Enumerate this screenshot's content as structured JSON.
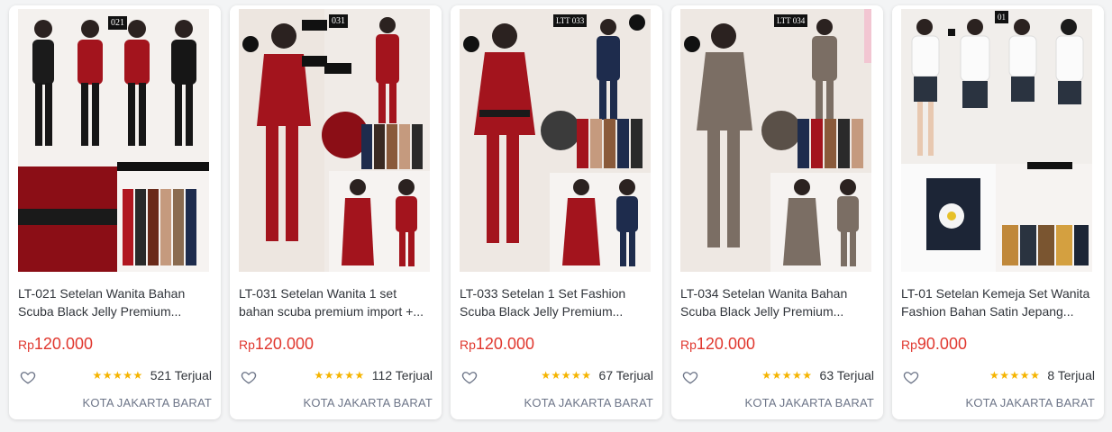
{
  "products": [
    {
      "code_tag": "021",
      "title": "LT-021 Setelan Wanita Bahan Scuba Black Jelly Premium...",
      "currency": "Rp",
      "price": "120.000",
      "stars": "★★★★★",
      "sold": "521 Terjual",
      "location": "KOTA JAKARTA BARAT"
    },
    {
      "code_tag": "031",
      "title": "LT-031 Setelan Wanita 1 set bahan scuba premium import +...",
      "currency": "Rp",
      "price": "120.000",
      "stars": "★★★★★",
      "sold": "112 Terjual",
      "location": "KOTA JAKARTA BARAT"
    },
    {
      "code_tag": "LTT 033",
      "title": "LT-033 Setelan 1 Set Fashion Scuba Black Jelly Premium...",
      "currency": "Rp",
      "price": "120.000",
      "stars": "★★★★★",
      "sold": "67 Terjual",
      "location": "KOTA JAKARTA BARAT"
    },
    {
      "code_tag": "LTT 034",
      "title": "LT-034 Setelan Wanita Bahan Scuba Black Jelly Premium...",
      "currency": "Rp",
      "price": "120.000",
      "stars": "★★★★★",
      "sold": "63 Terjual",
      "location": "KOTA JAKARTA BARAT"
    },
    {
      "code_tag": "01",
      "title": "LT-01 Setelan Kemeja Set Wanita Fashion Bahan Satin Jepang...",
      "currency": "Rp",
      "price": "90.000",
      "stars": "★★★★★",
      "sold": "8 Terjual",
      "location": "KOTA JAKARTA BARAT"
    }
  ],
  "icons": {
    "wishlist": "heart-icon",
    "rating": "star-icon"
  },
  "colors": {
    "price": "#e0372e",
    "star": "#f5b400",
    "location": "#6d7588",
    "text": "#31353b"
  }
}
